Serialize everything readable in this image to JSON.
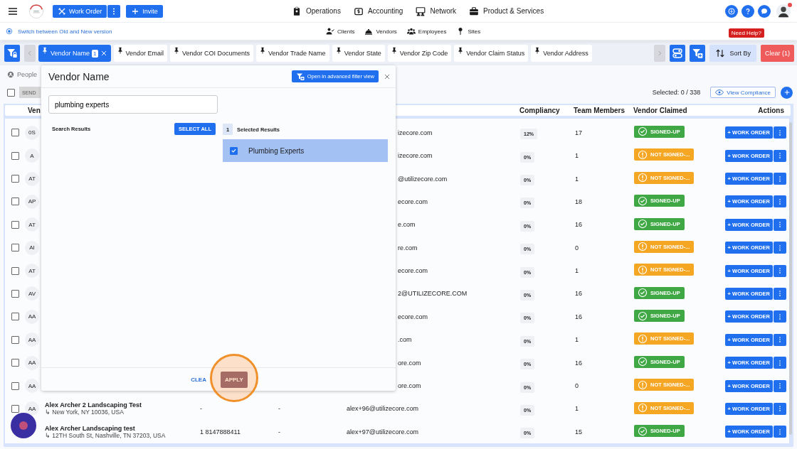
{
  "top_bar": {
    "work_order_button": "Work Order",
    "invite_button": "Invite",
    "nav": [
      {
        "label": "Operations",
        "kind": "clipboard"
      },
      {
        "label": "Accounting",
        "kind": "money"
      },
      {
        "label": "Network",
        "kind": "network"
      },
      {
        "label": "Product & Services",
        "kind": "briefcase"
      }
    ]
  },
  "sub_bar": {
    "version_link": "Switch between Old and New version",
    "nav": [
      {
        "label": "Clients",
        "kind": "client"
      },
      {
        "label": "Vendors",
        "kind": "bell"
      },
      {
        "label": "Employees",
        "kind": "group"
      },
      {
        "label": "Sites",
        "kind": "pin"
      }
    ],
    "help_badge": "Need Help?"
  },
  "filter_bar": {
    "chips": [
      {
        "label": "Vendor Name",
        "selected": true,
        "count": "1"
      },
      {
        "label": "Vendor Email",
        "selected": false
      },
      {
        "label": "Vendor COI Documents",
        "selected": false
      },
      {
        "label": "Vendor Trade Name",
        "selected": false
      },
      {
        "label": "Vendor State",
        "selected": false
      },
      {
        "label": "Vendor Zip Code",
        "selected": false
      },
      {
        "label": "Vendor Claim Status",
        "selected": false
      },
      {
        "label": "Vendor Address",
        "selected": false
      }
    ],
    "sort_button": "Sort By",
    "clear_button": "Clear (1)"
  },
  "toolbar": {
    "tab": "People",
    "select_all_checked": false,
    "send_button": {
      "label": "SEND",
      "disabled": true
    },
    "selected_count": "Selected: 0 / 338",
    "view_compliance_button": "View Compliance"
  },
  "table": {
    "columns": [
      "Ven",
      "Compliancy",
      "Team Members",
      "Vendor Claimed",
      "Actions"
    ],
    "rows": [
      {
        "kind": "covered",
        "checked": false,
        "initials": "0S",
        "email": "izecore.com",
        "compliancy": "12%",
        "team_members": "17",
        "claimed": {
          "text": "SIGNED-UP",
          "kind": "signed_up"
        },
        "action": "+ WORK ORDER"
      },
      {
        "kind": "covered",
        "checked": false,
        "initials": "A",
        "email": "izecore.com",
        "compliancy": "0%",
        "team_members": "1",
        "claimed": {
          "text": "NOT SIGNED-...",
          "kind": "not_signed"
        },
        "action": "+ WORK ORDER"
      },
      {
        "kind": "covered",
        "checked": false,
        "initials": "AT",
        "email": "@utilizecore.com",
        "compliancy": "0%",
        "team_members": "1",
        "claimed": {
          "text": "NOT SIGNED-...",
          "kind": "not_signed"
        },
        "action": "+ WORK ORDER"
      },
      {
        "kind": "covered",
        "checked": false,
        "initials": "AP",
        "email": "ecore.com",
        "compliancy": "0%",
        "team_members": "18",
        "claimed": {
          "text": "SIGNED-UP",
          "kind": "signed_up"
        },
        "action": "+ WORK ORDER"
      },
      {
        "kind": "covered",
        "checked": false,
        "initials": "AT",
        "email": "e.com",
        "compliancy": "0%",
        "team_members": "16",
        "claimed": {
          "text": "SIGNED-UP",
          "kind": "signed_up"
        },
        "action": "+ WORK ORDER"
      },
      {
        "kind": "covered",
        "checked": false,
        "initials": "AI",
        "email": "re.com",
        "compliancy": "0%",
        "team_members": "0",
        "claimed": {
          "text": "NOT SIGNED-...",
          "kind": "not_signed"
        },
        "action": "+ WORK ORDER"
      },
      {
        "kind": "covered",
        "checked": false,
        "initials": "AT",
        "email": "ecore.com",
        "compliancy": "0%",
        "team_members": "1",
        "claimed": {
          "text": "NOT SIGNED-...",
          "kind": "not_signed"
        },
        "action": "+ WORK ORDER"
      },
      {
        "kind": "covered",
        "checked": false,
        "initials": "AV",
        "email": "2@UTILIZECORE.COM",
        "compliancy": "0%",
        "team_members": "16",
        "claimed": {
          "text": "SIGNED-UP",
          "kind": "signed_up"
        },
        "action": "+ WORK ORDER"
      },
      {
        "kind": "covered",
        "checked": false,
        "initials": "AA",
        "email": "ecore.com",
        "compliancy": "0%",
        "team_members": "16",
        "claimed": {
          "text": "SIGNED-UP",
          "kind": "signed_up"
        },
        "action": "+ WORK ORDER"
      },
      {
        "kind": "covered",
        "checked": false,
        "initials": "AA",
        "email": ".com",
        "compliancy": "0%",
        "team_members": "1",
        "claimed": {
          "text": "NOT SIGNED-...",
          "kind": "not_signed"
        },
        "action": "+ WORK ORDER"
      },
      {
        "kind": "covered",
        "checked": false,
        "initials": "AA",
        "email": "ore.com",
        "compliancy": "0%",
        "team_members": "16",
        "claimed": {
          "text": "SIGNED-UP",
          "kind": "signed_up"
        },
        "action": "+ WORK ORDER"
      },
      {
        "kind": "covered",
        "checked": false,
        "initials": "AA",
        "email": "ore.com",
        "compliancy": "0%",
        "team_members": "0",
        "claimed": {
          "text": "NOT SIGNED-...",
          "kind": "not_signed"
        },
        "action": "+ WORK ORDER"
      },
      {
        "kind": "full",
        "checked": false,
        "initials": "AA",
        "name": "Alex Archer 2 Landscaping Test",
        "address": "↳ New York, NY 10036, USA",
        "phone": "-",
        "column_5": "-",
        "email": "alex+96@utilizecore.com",
        "compliancy": "0%",
        "team_members": "1",
        "claimed": {
          "text": "NOT SIGNED-...",
          "kind": "not_signed"
        },
        "action": "+ WORK ORDER"
      },
      {
        "kind": "full",
        "name": "Alex Archer Landscaping test",
        "address": "↳ 12TH South St, Nashville, TN 37203, USA",
        "phone": "1 8147888411",
        "column_5": "-",
        "email": "alex+97@utilizecore.com",
        "compliancy": "0%",
        "team_members": "15",
        "claimed": {
          "text": "SIGNED-UP",
          "kind": "signed_up"
        },
        "action": "+ WORK ORDER"
      }
    ]
  },
  "filter_popup": {
    "title": "Vendor Name",
    "advanced_button": "Open in advanced filter view",
    "search_value": "plumbing experts",
    "search_results_label": "Search Results",
    "select_all_button": "SELECT ALL",
    "selected_count": "1",
    "selected_label": "Selected Results",
    "selected_items": [
      {
        "label": "Plumbing Experts",
        "checked": true
      }
    ],
    "clear_button": "CLEA",
    "apply_button": "APPLY"
  }
}
